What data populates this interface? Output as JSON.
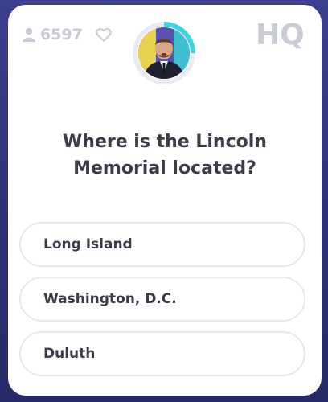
{
  "game": {
    "viewer_count": "6597",
    "logo_text": "HQ",
    "question": "Where is the Lincoln Memorial located?",
    "answers": [
      {
        "label": "Long Island"
      },
      {
        "label": "Washington, D.C."
      },
      {
        "label": "Duluth"
      }
    ],
    "icons": {
      "viewers": "person-icon",
      "like": "heart-icon",
      "timer": "timer-ring-icon"
    },
    "colors": {
      "background": "#2d3176",
      "card": "#ffffff",
      "muted": "#c9ccd6",
      "text": "#3a3d49",
      "timer_ring": "#40d2e0",
      "answer_border": "#e7e8ec"
    }
  }
}
